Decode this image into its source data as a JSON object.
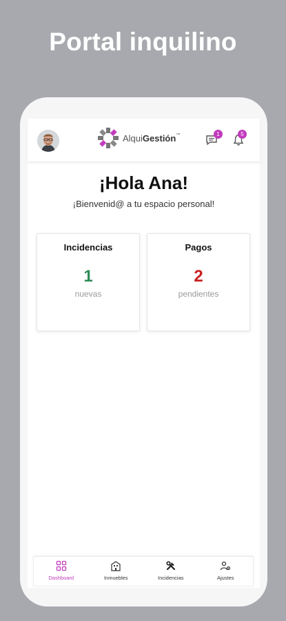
{
  "promo": {
    "title": "Portal inquilino"
  },
  "header": {
    "logo": {
      "alqui": "Alqui",
      "gestion": "Gestión",
      "tm": "™"
    },
    "messages_badge": "1",
    "notifications_badge": "5"
  },
  "main": {
    "greeting": "¡Hola Ana!",
    "welcome": "¡Bienvenid@ a tu espacio personal!",
    "cards": [
      {
        "title": "Incidencias",
        "value": "1",
        "subtitle": "nuevas",
        "color": "#2e8b57"
      },
      {
        "title": "Pagos",
        "value": "2",
        "subtitle": "pendientes",
        "color": "#cc1f1f"
      }
    ]
  },
  "bottom_nav": {
    "items": [
      {
        "label": "Dashboard",
        "icon": "dashboard-icon",
        "active": true
      },
      {
        "label": "Inmuebles",
        "icon": "building-icon"
      },
      {
        "label": "Incidencias",
        "icon": "tools-icon"
      },
      {
        "label": "Ajustes",
        "icon": "settings-icon"
      }
    ]
  },
  "colors": {
    "accent": "#c23bbd",
    "background": "#a7a9ae"
  }
}
